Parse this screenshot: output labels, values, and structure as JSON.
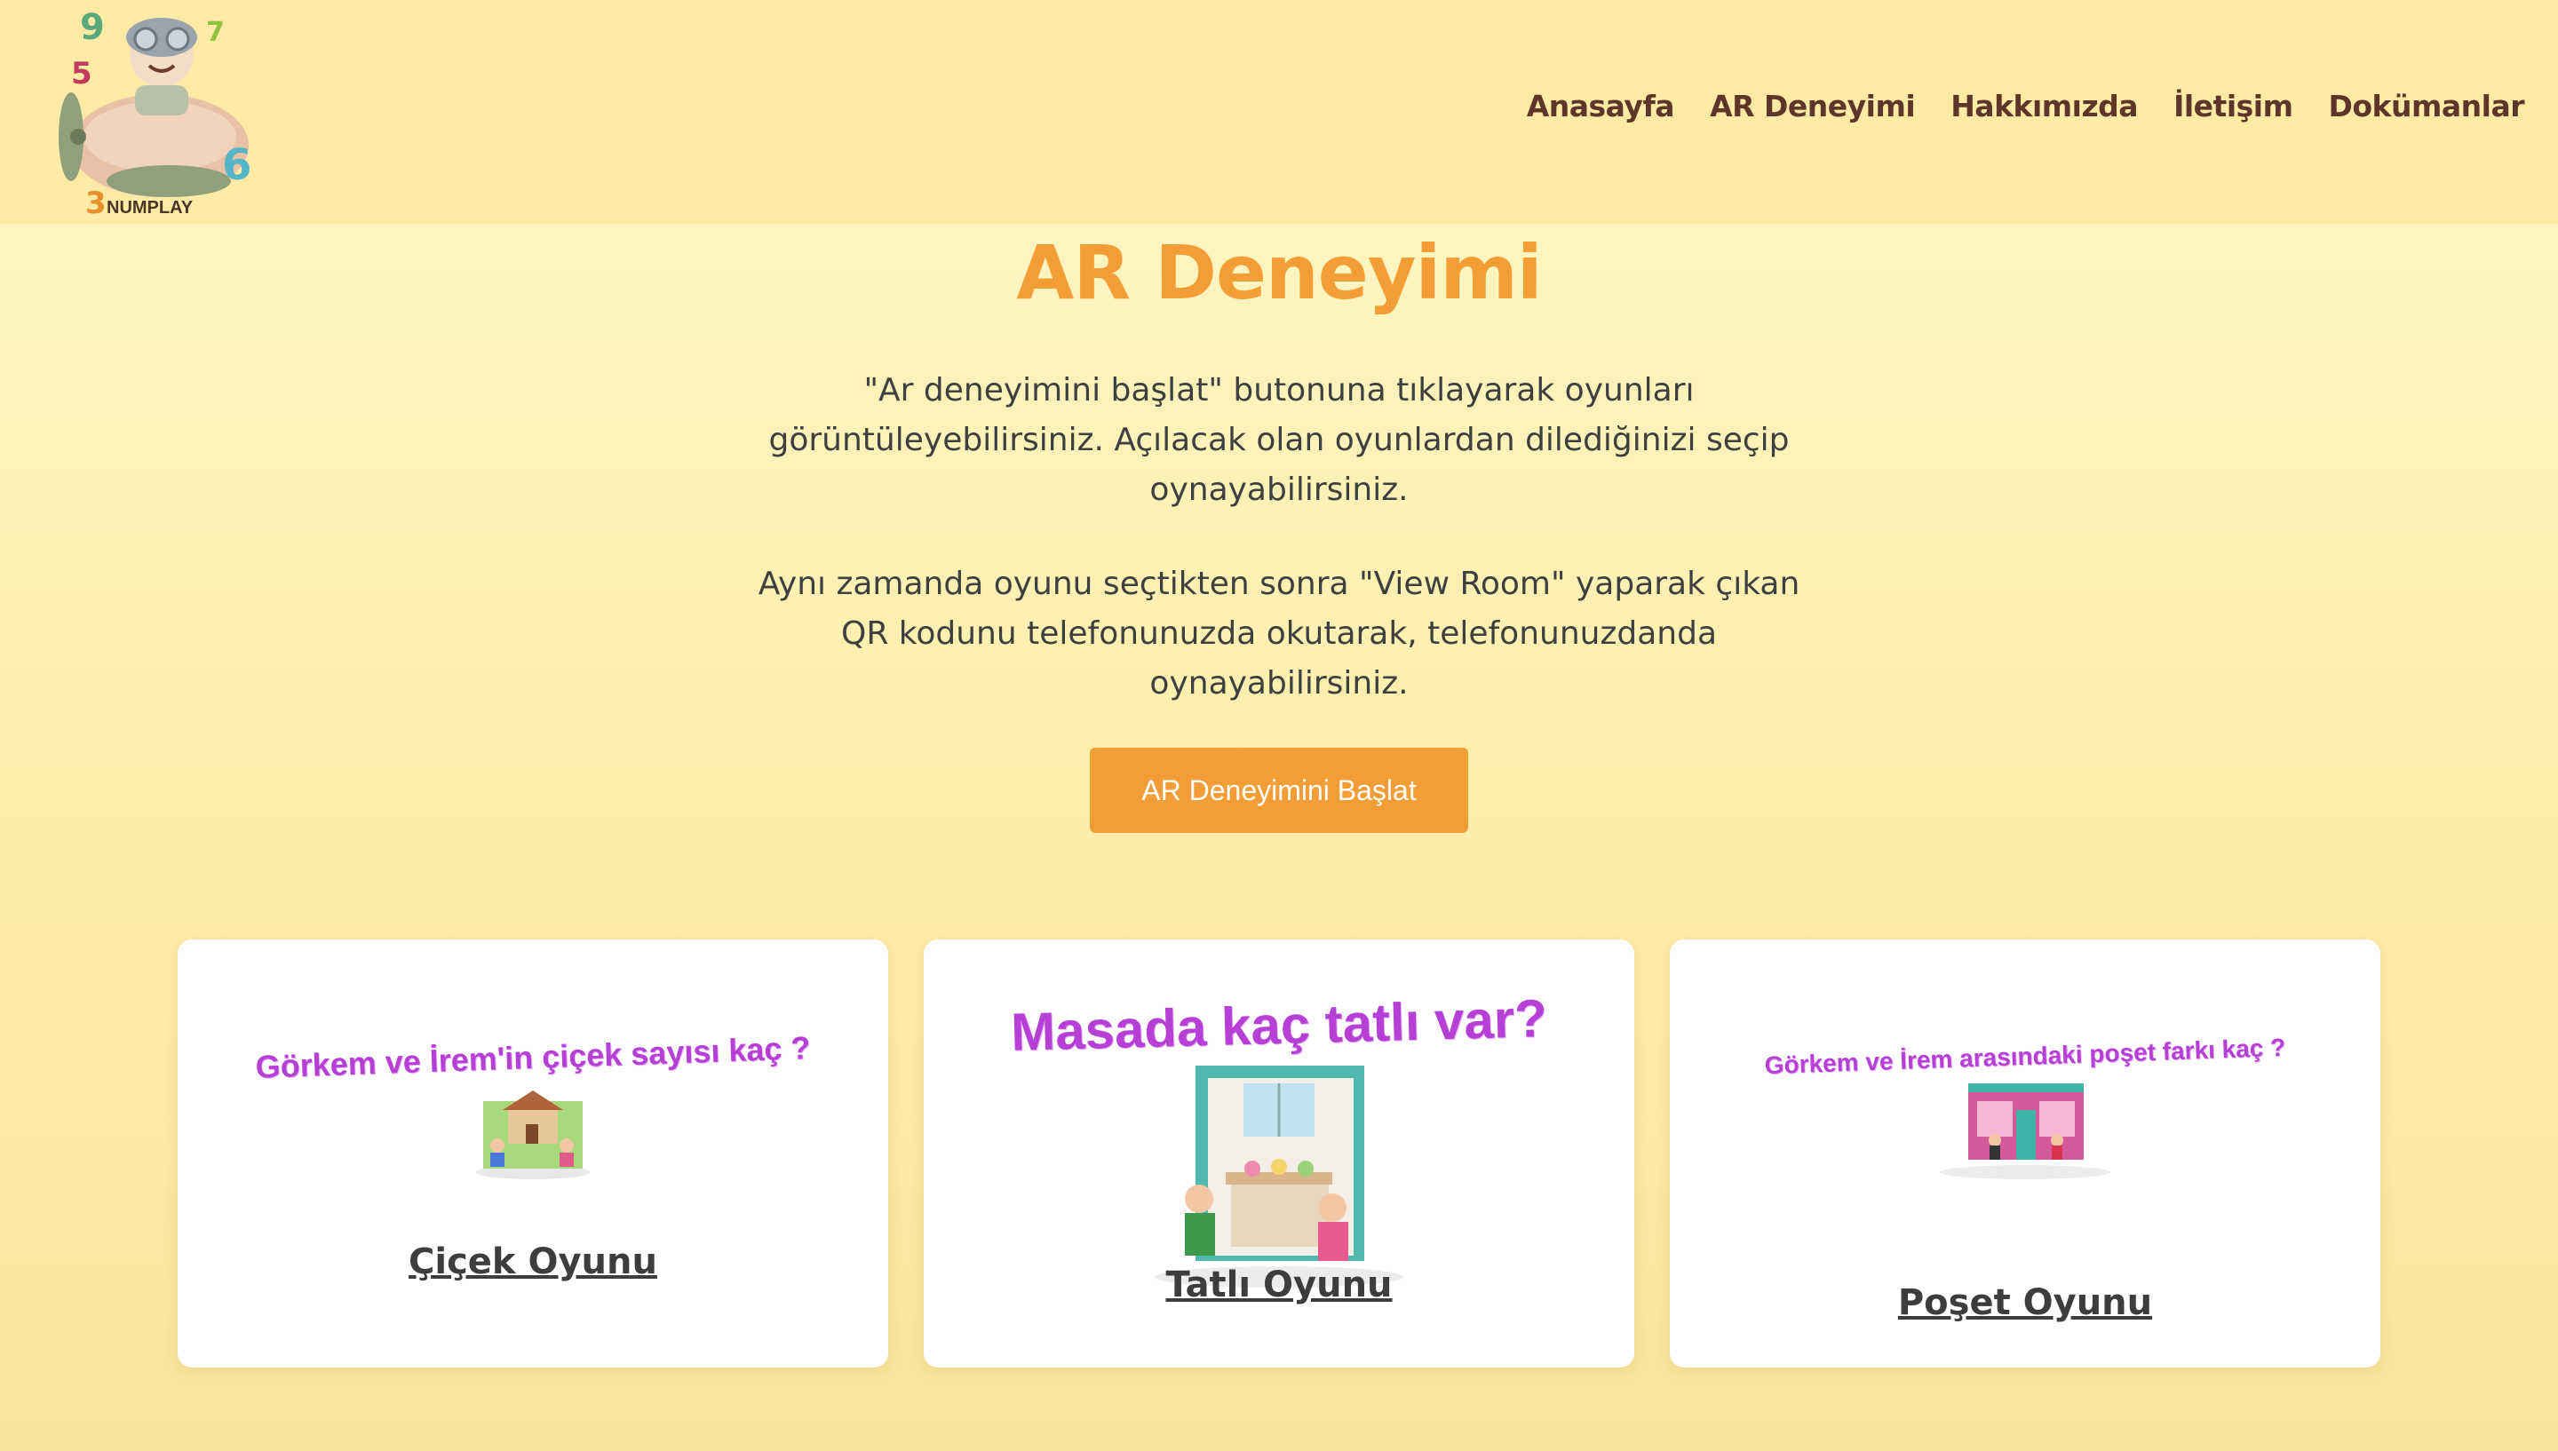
{
  "logo": {
    "text": "NUMPLAY",
    "digits": [
      "9",
      "5",
      "7",
      "6",
      "3"
    ]
  },
  "nav": {
    "items": [
      "Anasayfa",
      "AR Deneyimi",
      "Hakkımızda",
      "İletişim",
      "Dokümanlar"
    ]
  },
  "main": {
    "title": "AR Deneyimi",
    "paragraph1": "\"Ar deneyimini başlat\" butonuna tıklayarak oyunları görüntüleyebilirsiniz. Açılacak olan oyunlardan dilediğinizi seçip oynayabilirsiniz.",
    "paragraph2": "Aynı zamanda oyunu seçtikten sonra \"View Room\" yaparak çıkan QR kodunu telefonunuzda okutarak, telefonunuzdanda oynayabilirsiniz.",
    "start_button": "AR Deneyimini Başlat"
  },
  "cards": [
    {
      "question": "Görkem ve İrem'in çiçek sayısı kaç ?",
      "link": "Çiçek Oyunu"
    },
    {
      "question": "Masada kaç tatlı var?",
      "link": "Tatlı Oyunu"
    },
    {
      "question": "Görkem ve İrem arasındaki poşet farkı kaç ?",
      "link": "Poşet Oyunu"
    }
  ],
  "colors": {
    "accent": "#f29d35",
    "nav_text": "#5e3528",
    "header_bg": "#fdeba5",
    "card_heading": "#b63fd6"
  }
}
